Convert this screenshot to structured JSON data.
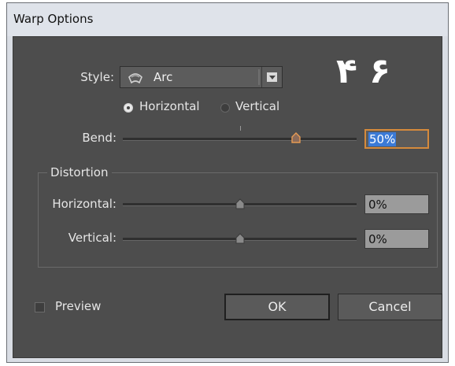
{
  "window": {
    "title": "Warp Options"
  },
  "style": {
    "label": "Style:",
    "value": "Arc",
    "icon": "arc-warp-icon"
  },
  "overlay_text": "۴ ۶",
  "orientation": {
    "horizontal_label": "Horizontal",
    "vertical_label": "Vertical",
    "selected": "Horizontal"
  },
  "bend": {
    "label": "Bend:",
    "value": "50%",
    "level_percent": 50
  },
  "distortion": {
    "title": "Distortion",
    "horizontal": {
      "label": "Horizontal:",
      "value": "0%"
    },
    "vertical": {
      "label": "Vertical:",
      "value": "0%"
    }
  },
  "preview": {
    "label": "Preview",
    "checked": false
  },
  "buttons": {
    "ok": "OK",
    "cancel": "Cancel"
  },
  "colors": {
    "panel": "#4d4d4d",
    "focus_border": "#d58a3c",
    "selection": "#3b7ad6"
  }
}
